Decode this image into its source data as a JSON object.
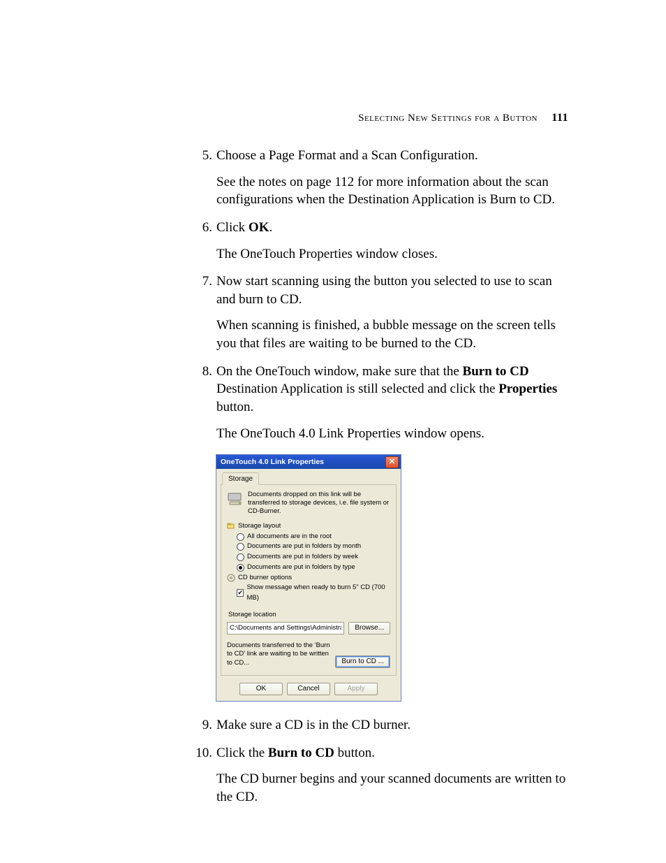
{
  "header": {
    "section_title": "Selecting New Settings for a Button",
    "page_number": "111"
  },
  "steps": {
    "s5": {
      "num": "5.",
      "text": "Choose a Page Format and a Scan Configuration.",
      "para": "See the notes on page 112 for more information about the scan configurations when the Destination Application is Burn to CD."
    },
    "s6": {
      "num": "6.",
      "prefix": "Click ",
      "bold": "OK",
      "suffix": ".",
      "para": "The OneTouch Properties window closes."
    },
    "s7": {
      "num": "7.",
      "text": "Now start scanning using the button you selected to use to scan and burn to CD.",
      "para": "When scanning is finished, a bubble message on the screen tells you that files are waiting to be burned to the CD."
    },
    "s8": {
      "num": "8.",
      "prefix": "On the OneTouch window, make sure that the ",
      "bold1": "Burn to CD",
      "mid": " Destination Application is still selected and click the ",
      "bold2": "Properties",
      "suffix": " button.",
      "para": "The OneTouch 4.0 Link Properties window opens."
    },
    "s9": {
      "num": "9.",
      "text": "Make sure a CD is in the CD burner."
    },
    "s10": {
      "num": "10.",
      "prefix": "Click the ",
      "bold": "Burn to CD",
      "suffix": " button.",
      "para": "The CD burner begins and your scanned documents are written to the CD."
    }
  },
  "dialog": {
    "title": "OneTouch 4.0 Link Properties",
    "tab": "Storage",
    "info": "Documents dropped on this link will be transferred to storage devices, i.e. file system or CD-Burner.",
    "tree": {
      "storage_layout": "Storage layout",
      "opt_root": "All documents are in the root",
      "opt_month": "Documents are put in folders by month",
      "opt_week": "Documents are put in folders by week",
      "opt_type": "Documents are put in folders by type",
      "cd_opts": "CD burner options",
      "cd_msg": "Show message when ready to burn 5\" CD (700 MB)"
    },
    "storage_location_label": "Storage location",
    "storage_location_value": "C:\\Documents and Settings\\Administrator\\My Do",
    "browse": "Browse...",
    "wait_text": "Documents transferred to the 'Burn to CD' link are waiting to be written to CD...",
    "burn": "Burn to CD ...",
    "ok": "OK",
    "cancel": "Cancel",
    "apply": "Apply"
  }
}
